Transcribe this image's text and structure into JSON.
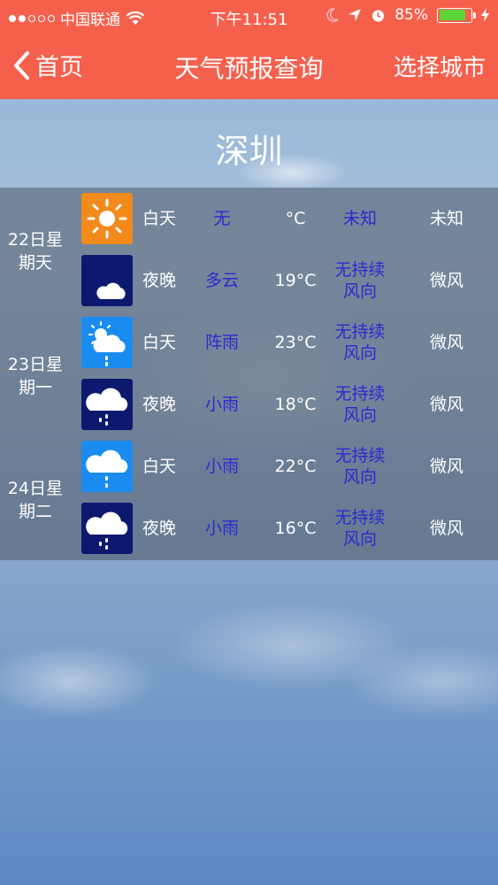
{
  "status_bar": {
    "carrier": "中国联通",
    "time": "下午11:51",
    "battery": "85%",
    "battery_level": 0.85,
    "signal_dots_filled": 2
  },
  "nav": {
    "back_label": "首页",
    "title": "天气预报查询",
    "right_label": "选择城市"
  },
  "city": "深圳",
  "colors": {
    "nav_bg": "#f5604d",
    "link_text": "#2a2ad0",
    "day_icon_bg": "#1a8cf0",
    "night_icon_bg": "#0b1a6e",
    "sun_icon_bg": "#f28a1c"
  },
  "days": [
    {
      "label": "22日星期天",
      "label_line1": "22日星",
      "label_line2": "期天",
      "rows": [
        {
          "icon": "sunny-icon",
          "period": "白天",
          "weather": "无",
          "temp": "°C",
          "wind_dir": "未知",
          "wind_dir_line2": "",
          "wind_power": "未知"
        },
        {
          "icon": "moon-cloud-icon",
          "period": "夜晚",
          "weather": "多云",
          "temp": "19°C",
          "wind_dir": "无持续",
          "wind_dir_line2": "风向",
          "wind_power": "微风"
        }
      ]
    },
    {
      "label": "23日星期一",
      "label_line1": "23日星",
      "label_line2": "期一",
      "rows": [
        {
          "icon": "sun-cloud-rain-icon",
          "period": "白天",
          "weather": "阵雨",
          "temp": "23°C",
          "wind_dir": "无持续",
          "wind_dir_line2": "风向",
          "wind_power": "微风"
        },
        {
          "icon": "cloud-rain-night-icon",
          "period": "夜晚",
          "weather": "小雨",
          "temp": "18°C",
          "wind_dir": "无持续",
          "wind_dir_line2": "风向",
          "wind_power": "微风"
        }
      ]
    },
    {
      "label": "24日星期二",
      "label_line1": "24日星",
      "label_line2": "期二",
      "rows": [
        {
          "icon": "cloud-rain-day-icon",
          "period": "白天",
          "weather": "小雨",
          "temp": "22°C",
          "wind_dir": "无持续",
          "wind_dir_line2": "风向",
          "wind_power": "微风"
        },
        {
          "icon": "cloud-rain-night-icon",
          "period": "夜晚",
          "weather": "小雨",
          "temp": "16°C",
          "wind_dir": "无持续",
          "wind_dir_line2": "风向",
          "wind_power": "微风"
        }
      ]
    }
  ]
}
